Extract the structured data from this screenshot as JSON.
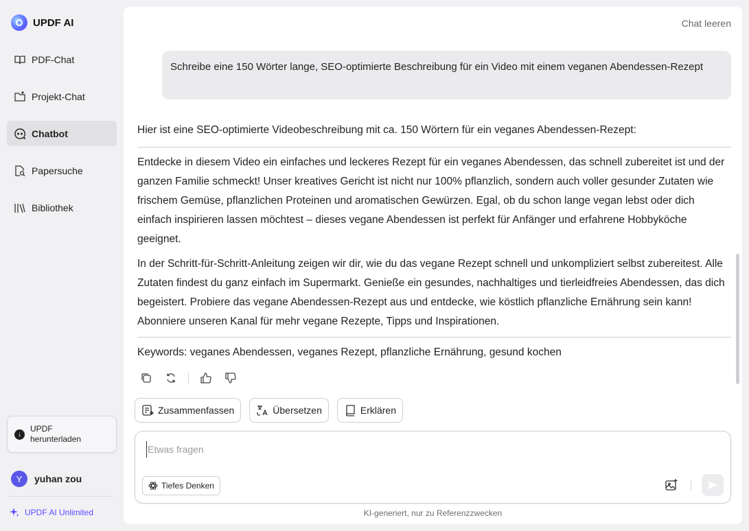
{
  "brand": {
    "name": "UPDF AI"
  },
  "sidebar": {
    "items": [
      {
        "label": "PDF-Chat",
        "icon": "book-open-icon",
        "active": false
      },
      {
        "label": "Projekt-Chat",
        "icon": "folder-plus-icon",
        "active": false
      },
      {
        "label": "Chatbot",
        "icon": "chat-bot-icon",
        "active": true
      },
      {
        "label": "Papersuche",
        "icon": "paper-search-icon",
        "active": false
      },
      {
        "label": "Bibliothek",
        "icon": "library-icon",
        "active": false
      }
    ],
    "download": {
      "line1": "UPDF",
      "line2": "herunterladen"
    },
    "user": {
      "initial": "Y",
      "name": "yuhan zou"
    },
    "unlimited": "UPDF AI Unlimited"
  },
  "header": {
    "clear_label": "Chat leeren"
  },
  "conversation": {
    "user_message": "Schreibe eine 150 Wörter lange, SEO-optimierte Beschreibung für ein Video mit einem veganen Abendessen-Rezept",
    "answer": {
      "intro": "Hier ist eine SEO-optimierte Videobeschreibung mit ca. 150 Wörtern für ein veganes Abendessen-Rezept:",
      "paragraph1": "Entdecke in diesem Video ein einfaches und leckeres Rezept für ein veganes Abendessen, das schnell zubereitet ist und der ganzen Familie schmeckt! Unser kreatives Gericht ist nicht nur 100% pflanzlich, sondern auch voller gesunder Zutaten wie frischem Gemüse, pflanzlichen Proteinen und aromatischen Gewürzen. Egal, ob du schon lange vegan lebst oder dich einfach inspirieren lassen möchtest – dieses vegane Abendessen ist perfekt für Anfänger und erfahrene Hobbyköche geeignet.",
      "paragraph2": "In der Schritt-für-Schritt-Anleitung zeigen wir dir, wie du das vegane Rezept schnell und unkompliziert selbst zubereitest. Alle Zutaten findest du ganz einfach im Supermarkt. Genieße ein gesundes, nachhaltiges und tierleidfreies Abendessen, das dich begeistert. Probiere das vegane Abendessen-Rezept aus und entdecke, wie köstlich pflanzliche Ernährung sein kann! Abonniere unseren Kanal für mehr vegane Rezepte, Tipps und Inspirationen.",
      "keywords": "Keywords: veganes Abendessen, veganes Rezept, pflanzliche Ernährung, gesund kochen"
    }
  },
  "quick_actions": {
    "summarize": "Zusammenfassen",
    "translate": "Übersetzen",
    "explain": "Erklären"
  },
  "composer": {
    "placeholder": "Etwas fragen",
    "deep_think": "Tiefes Denken"
  },
  "footer": {
    "disclaimer": "KI-generiert, nur zu Referenzzwecken"
  },
  "colors": {
    "accent": "#5a4bff",
    "active_bg": "#e1e1e4",
    "app_bg": "#f1f1f3"
  }
}
